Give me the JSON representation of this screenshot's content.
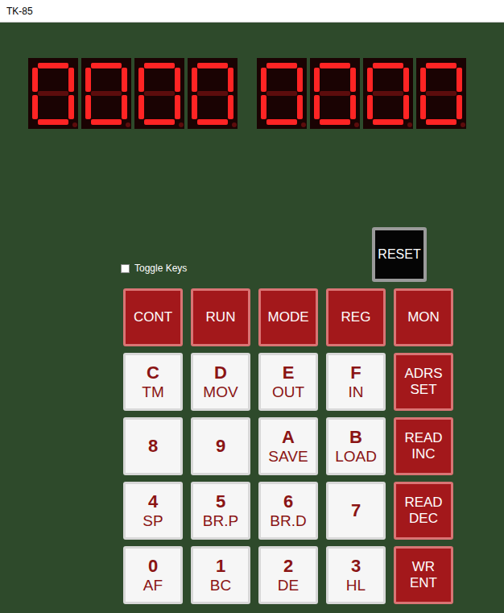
{
  "window": {
    "title": "TK-85"
  },
  "display": {
    "groups": [
      [
        "0",
        "0",
        "0",
        "0"
      ],
      [
        "0",
        "0",
        "0",
        "0"
      ]
    ]
  },
  "toggle_keys": {
    "label": "Toggle Keys",
    "checked": false
  },
  "reset_button": {
    "label": "RESET"
  },
  "keypad": {
    "keys": [
      {
        "kind": "function",
        "lines": [
          "CONT"
        ]
      },
      {
        "kind": "function",
        "lines": [
          "RUN"
        ]
      },
      {
        "kind": "function",
        "lines": [
          "MODE"
        ]
      },
      {
        "kind": "function",
        "lines": [
          "REG"
        ]
      },
      {
        "kind": "function",
        "lines": [
          "MON"
        ]
      },
      {
        "kind": "hex",
        "lines": [
          "C",
          "TM"
        ]
      },
      {
        "kind": "hex",
        "lines": [
          "D",
          "MOV"
        ]
      },
      {
        "kind": "hex",
        "lines": [
          "E",
          "OUT"
        ]
      },
      {
        "kind": "hex",
        "lines": [
          "F",
          "IN"
        ]
      },
      {
        "kind": "function",
        "lines": [
          "ADRS",
          "SET"
        ]
      },
      {
        "kind": "hex",
        "lines": [
          "8"
        ]
      },
      {
        "kind": "hex",
        "lines": [
          "9"
        ]
      },
      {
        "kind": "hex",
        "lines": [
          "A",
          "SAVE"
        ]
      },
      {
        "kind": "hex",
        "lines": [
          "B",
          "LOAD"
        ]
      },
      {
        "kind": "function",
        "lines": [
          "READ",
          "INC"
        ]
      },
      {
        "kind": "hex",
        "lines": [
          "4",
          "SP"
        ]
      },
      {
        "kind": "hex",
        "lines": [
          "5",
          "BR.P"
        ]
      },
      {
        "kind": "hex",
        "lines": [
          "6",
          "BR.D"
        ]
      },
      {
        "kind": "hex",
        "lines": [
          "7"
        ]
      },
      {
        "kind": "function",
        "lines": [
          "READ",
          "DEC"
        ]
      },
      {
        "kind": "hex",
        "lines": [
          "0",
          "AF"
        ]
      },
      {
        "kind": "hex",
        "lines": [
          "1",
          "BC"
        ]
      },
      {
        "kind": "hex",
        "lines": [
          "2",
          "DE"
        ]
      },
      {
        "kind": "hex",
        "lines": [
          "3",
          "HL"
        ]
      },
      {
        "kind": "function",
        "lines": [
          "WR",
          "ENT"
        ]
      }
    ]
  }
}
